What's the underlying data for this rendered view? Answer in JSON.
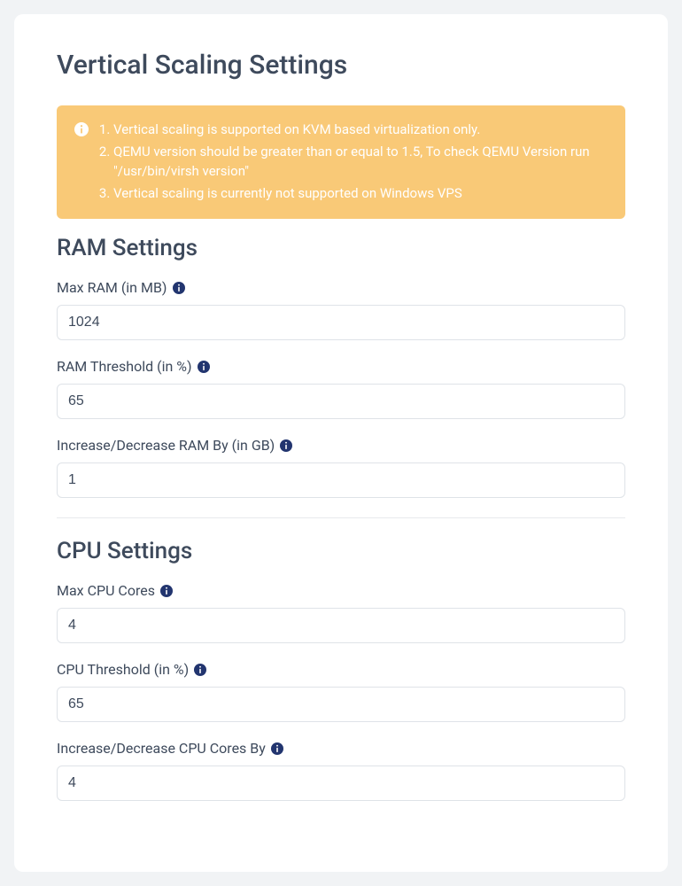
{
  "title": "Vertical Scaling Settings",
  "alert": {
    "items": [
      "Vertical scaling is supported on KVM based virtualization only.",
      "QEMU version should be greater than or equal to 1.5, To check QEMU Version run \"/usr/bin/virsh version\"",
      "Vertical scaling is currently not supported on Windows VPS"
    ]
  },
  "ram": {
    "heading": "RAM Settings",
    "maxRam": {
      "label": "Max RAM (in MB)",
      "value": "1024"
    },
    "threshold": {
      "label": "RAM Threshold (in %)",
      "value": "65"
    },
    "step": {
      "label": "Increase/Decrease RAM By (in GB)",
      "value": "1"
    }
  },
  "cpu": {
    "heading": "CPU Settings",
    "maxCores": {
      "label": "Max CPU Cores",
      "value": "4"
    },
    "threshold": {
      "label": "CPU Threshold (in %)",
      "value": "65"
    },
    "step": {
      "label": "Increase/Decrease CPU Cores By",
      "value": "4"
    }
  },
  "colors": {
    "infoIcon": "#22356f",
    "alertBg": "#f9c977"
  }
}
